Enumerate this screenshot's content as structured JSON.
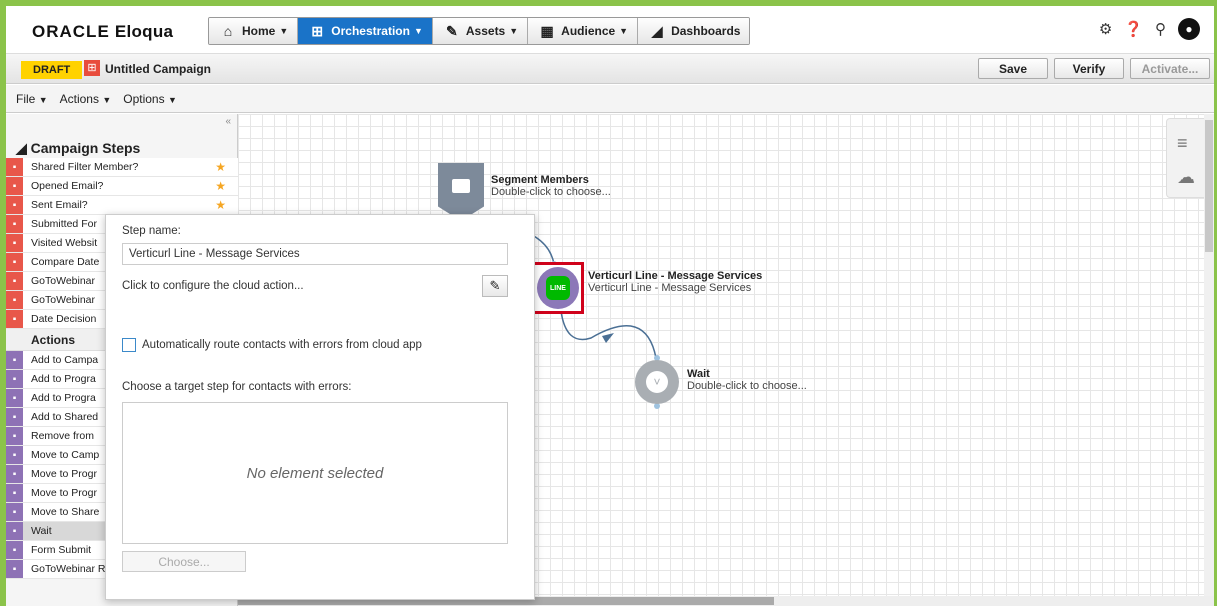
{
  "app": {
    "logo_brand": "ORACLE",
    "logo_product": "Eloqua"
  },
  "nav": {
    "items": [
      {
        "label": "Home",
        "icon": "home-icon",
        "has_caret": true
      },
      {
        "label": "Orchestration",
        "icon": "orchestration-icon",
        "has_caret": true,
        "active": true
      },
      {
        "label": "Assets",
        "icon": "assets-icon",
        "has_caret": true
      },
      {
        "label": "Audience",
        "icon": "audience-icon",
        "has_caret": true
      },
      {
        "label": "Dashboards",
        "icon": "dashboards-icon",
        "has_caret": false
      }
    ]
  },
  "campaign": {
    "status": "DRAFT",
    "title": "Untitled Campaign",
    "save_label": "Save",
    "verify_label": "Verify",
    "activate_label": "Activate..."
  },
  "menu": {
    "file": "File",
    "actions": "Actions",
    "options": "Options"
  },
  "sidebar": {
    "collapse_glyph": "«",
    "title": "Campaign Steps",
    "rows": [
      {
        "label": "Shared Filter Member?",
        "color": "#e8574a",
        "icon": "filter-icon",
        "star": "gold"
      },
      {
        "label": "Opened Email?",
        "color": "#e8574a",
        "icon": "email-icon",
        "star": "gold"
      },
      {
        "label": "Sent Email?",
        "color": "#e8574a",
        "icon": "sent-email-icon",
        "star": "gold"
      },
      {
        "label": "Submitted For",
        "color": "#e8574a",
        "icon": "form-icon",
        "star": ""
      },
      {
        "label": "Visited Websit",
        "color": "#e8574a",
        "icon": "web-icon",
        "star": ""
      },
      {
        "label": "Compare Date",
        "color": "#e8574a",
        "icon": "compare-icon",
        "star": ""
      },
      {
        "label": "GoToWebinar",
        "color": "#e8574a",
        "icon": "webinar-icon",
        "star": ""
      },
      {
        "label": "GoToWebinar",
        "color": "#e8574a",
        "icon": "webinar-icon",
        "star": ""
      },
      {
        "label": "Date Decision",
        "color": "#e8574a",
        "icon": "calendar-icon",
        "star": ""
      }
    ],
    "actions_header": "Actions",
    "action_rows": [
      {
        "label": "Add to Campa",
        "color": "#8e72b5",
        "icon": "add-campaign-icon"
      },
      {
        "label": "Add to Progra",
        "color": "#8e72b5",
        "icon": "add-program-icon"
      },
      {
        "label": "Add to Progra",
        "color": "#8e72b5",
        "icon": "add-program-icon"
      },
      {
        "label": "Add to Shared",
        "color": "#8e72b5",
        "icon": "add-shared-icon"
      },
      {
        "label": "Remove from",
        "color": "#8e72b5",
        "icon": "remove-icon"
      },
      {
        "label": "Move to Camp",
        "color": "#8e72b5",
        "icon": "move-campaign-icon"
      },
      {
        "label": "Move to Progr",
        "color": "#8e72b5",
        "icon": "move-program-icon"
      },
      {
        "label": "Move to Progr",
        "color": "#8e72b5",
        "icon": "move-program-icon"
      },
      {
        "label": "Move to Share",
        "color": "#8e72b5",
        "icon": "move-shared-icon"
      },
      {
        "label": "Wait",
        "color": "#8e72b5",
        "icon": "clock-icon",
        "highlight": true
      },
      {
        "label": "Form Submit",
        "color": "#8e72b5",
        "icon": "form-submit-icon"
      },
      {
        "label": "GoToWebinar Register",
        "color": "#8e72b5",
        "icon": "webinar-icon",
        "star": "grey"
      }
    ]
  },
  "canvas": {
    "segment": {
      "title": "Segment Members",
      "subtitle": "Double-click to choose..."
    },
    "line_step": {
      "title": "Verticurl Line - Message Services",
      "subtitle": "Verticurl Line - Message Services",
      "badge": "LINE"
    },
    "wait": {
      "title": "Wait",
      "subtitle": "Double-click to choose..."
    }
  },
  "popup": {
    "step_name_label": "Step name:",
    "step_name_value": "Verticurl Line - Message Services",
    "configure_text": "Click to configure the cloud action...",
    "auto_route_label": "Automatically route contacts with errors from cloud app",
    "target_label": "Choose a target step for contacts with errors:",
    "empty_text": "No element selected",
    "choose_label": "Choose..."
  },
  "colors": {
    "accent": "#1a73c8",
    "draft": "#ffd200",
    "frame": "#8bc34a",
    "highlight_border": "#d0021b"
  }
}
